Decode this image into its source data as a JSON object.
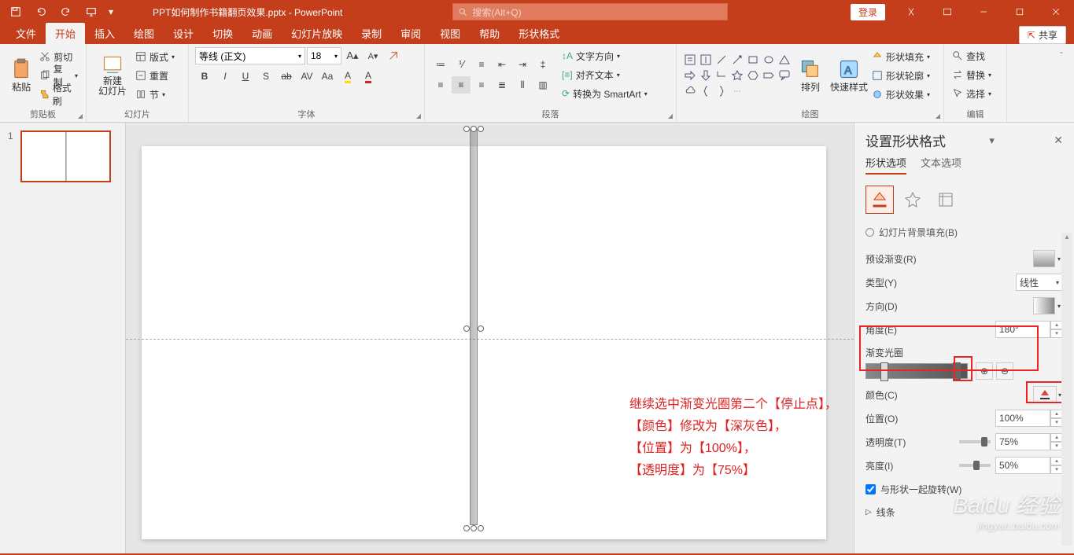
{
  "titlebar": {
    "filename": "PPT如何制作书籍翻页效果.pptx - PowerPoint",
    "search_placeholder": "搜索(Alt+Q)",
    "login": "登录"
  },
  "tabs": {
    "file": "文件",
    "home": "开始",
    "insert": "插入",
    "draw": "绘图",
    "design": "设计",
    "transition": "切换",
    "animation": "动画",
    "slideshow": "幻灯片放映",
    "record": "录制",
    "review": "审阅",
    "view": "视图",
    "help": "帮助",
    "shapeformat": "形状格式",
    "share": "共享"
  },
  "ribbon": {
    "clipboard": {
      "label": "剪贴板",
      "paste": "粘贴",
      "cut": "剪切",
      "copy": "复制",
      "formatpainter": "格式刷"
    },
    "slides": {
      "label": "幻灯片",
      "newslide": "新建\n幻灯片",
      "layout": "版式",
      "reset": "重置",
      "section": "节"
    },
    "font": {
      "label": "字体",
      "fontname": "等线 (正文)",
      "fontsize": "18"
    },
    "paragraph": {
      "label": "段落",
      "textdir": "文字方向",
      "align": "对齐文本",
      "smartart": "转换为 SmartArt"
    },
    "drawing": {
      "label": "绘图",
      "arrange": "排列",
      "quickstyle": "快速样式",
      "shapefill": "形状填充",
      "shapeoutline": "形状轮廓",
      "shapeeffects": "形状效果"
    },
    "editing": {
      "label": "编辑",
      "find": "查找",
      "replace": "替换",
      "select": "选择"
    }
  },
  "thumbpanel": {
    "slide1_num": "1"
  },
  "annotation": {
    "l1": "继续选中渐变光圈第二个【停止点】，",
    "l2": "【颜色】修改为【深灰色】，",
    "l3": "【位置】为【100%】，",
    "l4": "【透明度】为【75%】"
  },
  "pane": {
    "title": "设置形状格式",
    "tab_shape": "形状选项",
    "tab_text": "文本选项",
    "radio_pattern": "幻灯片背景填充(B)",
    "preset": "预设渐变(R)",
    "type": "类型(Y)",
    "type_val": "线性",
    "direction": "方向(D)",
    "angle": "角度(E)",
    "angle_val": "180°",
    "stops": "渐变光圈",
    "color": "颜色(C)",
    "position": "位置(O)",
    "position_val": "100%",
    "transparency": "透明度(T)",
    "transparency_val": "75%",
    "brightness": "亮度(I)",
    "brightness_val": "50%",
    "rotate_with": "与形状一起旋转(W)",
    "line_section": "线条"
  },
  "watermark": {
    "brand": "Baidu 经验",
    "sub": "jingyan.baidu.com"
  }
}
